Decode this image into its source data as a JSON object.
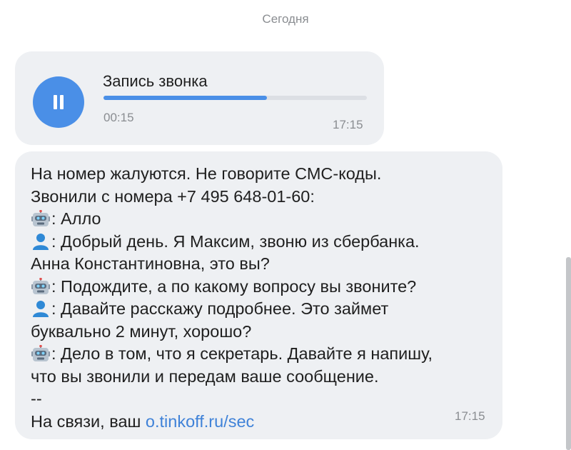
{
  "date_divider": "Сегодня",
  "call_record": {
    "title": "Запись звонка",
    "duration": "00:15",
    "time": "17:15",
    "progress": 0.62,
    "state_icon": "pause-icon",
    "accent_color": "#4a8fe7"
  },
  "message": {
    "line1": "На номер жалуются. Не говорите СМС-коды.",
    "line2": "Звонили с номера +7 495 648-01-60:",
    "line3": ": Алло",
    "line4": ": Добрый день. Я Максим, звоню из сбербанка.",
    "line5": "Анна Константиновна, это вы?",
    "line6": ": Подождите, а по какому вопросу вы звоните?",
    "line7": ": Давайте расскажу подробнее. Это займет",
    "line8": "буквально 2 минут, хорошо?",
    "line9": ": Дело в том, что я секретарь. Давайте я напишу,",
    "line10": "что вы звонили и передам ваше сообщение.",
    "separator": "--",
    "signature_prefix": "На связи, ваш ",
    "link_text": "o.tinkoff.ru/sec",
    "time": "17:15",
    "speaker_icons": {
      "robot": "robot-icon",
      "person": "person-icon"
    },
    "link_color": "#3f82d8"
  }
}
